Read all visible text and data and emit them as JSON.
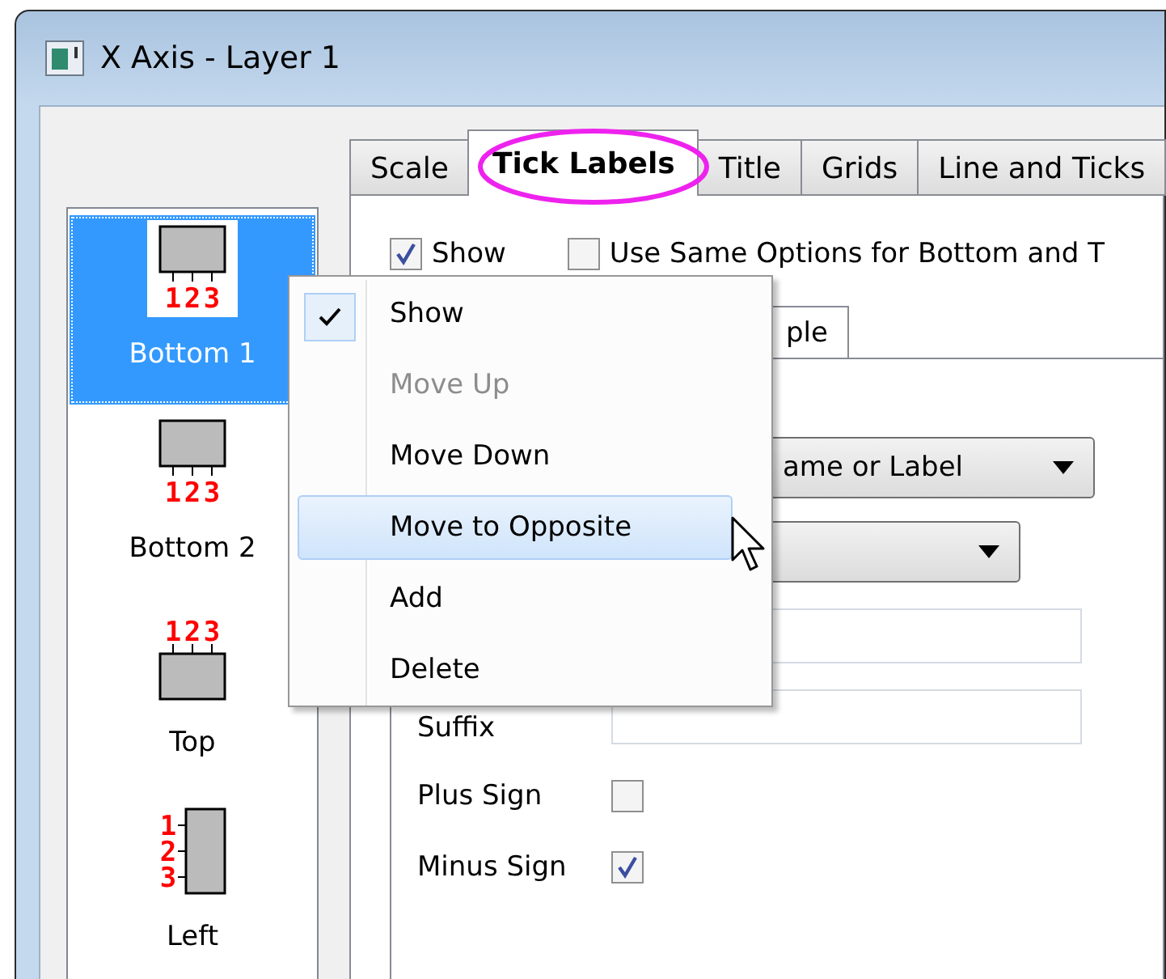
{
  "window": {
    "title": "X Axis - Layer 1"
  },
  "axes": [
    {
      "label": "Bottom 1",
      "kind": "bottom",
      "tick_text": "123",
      "selected": true
    },
    {
      "label": "Bottom 2",
      "kind": "bottom",
      "tick_text": "123",
      "selected": false
    },
    {
      "label": "Top",
      "kind": "top",
      "tick_text": "123",
      "selected": false
    },
    {
      "label": "Left",
      "kind": "left",
      "tick_text": "123",
      "selected": false
    }
  ],
  "tabs": [
    {
      "label": "Scale",
      "selected": false
    },
    {
      "label": "Tick Labels",
      "selected": true
    },
    {
      "label": "Title",
      "selected": false
    },
    {
      "label": "Grids",
      "selected": false
    },
    {
      "label": "Line and Ticks",
      "selected": false
    }
  ],
  "show": {
    "label": "Show",
    "checked": true
  },
  "same_options": {
    "label": "Use Same Options for Bottom and T",
    "checked": false
  },
  "sub_tab": {
    "label": "ple"
  },
  "dropdowns": [
    {
      "kind": "value",
      "value": "ame or Label"
    },
    {
      "kind": "empty"
    }
  ],
  "fields": [
    {
      "kind": "text"
    },
    {
      "kind": "text",
      "label": "Suffix"
    },
    {
      "kind": "checkbox",
      "label": "Plus Sign",
      "checked": false
    },
    {
      "kind": "checkbox",
      "label": "Minus Sign",
      "checked": true
    }
  ],
  "context_menu": {
    "items": [
      {
        "label": "Show",
        "checked": true,
        "disabled": false,
        "selected": false
      },
      {
        "label": "Move Up",
        "checked": false,
        "disabled": true,
        "selected": false
      },
      {
        "label": "Move Down",
        "checked": false,
        "disabled": false,
        "selected": false
      },
      {
        "label": "Move to Opposite",
        "checked": false,
        "disabled": false,
        "selected": true
      },
      {
        "label": "Add",
        "checked": false,
        "disabled": false,
        "selected": false
      },
      {
        "label": "Delete",
        "checked": false,
        "disabled": false,
        "selected": false
      }
    ]
  }
}
